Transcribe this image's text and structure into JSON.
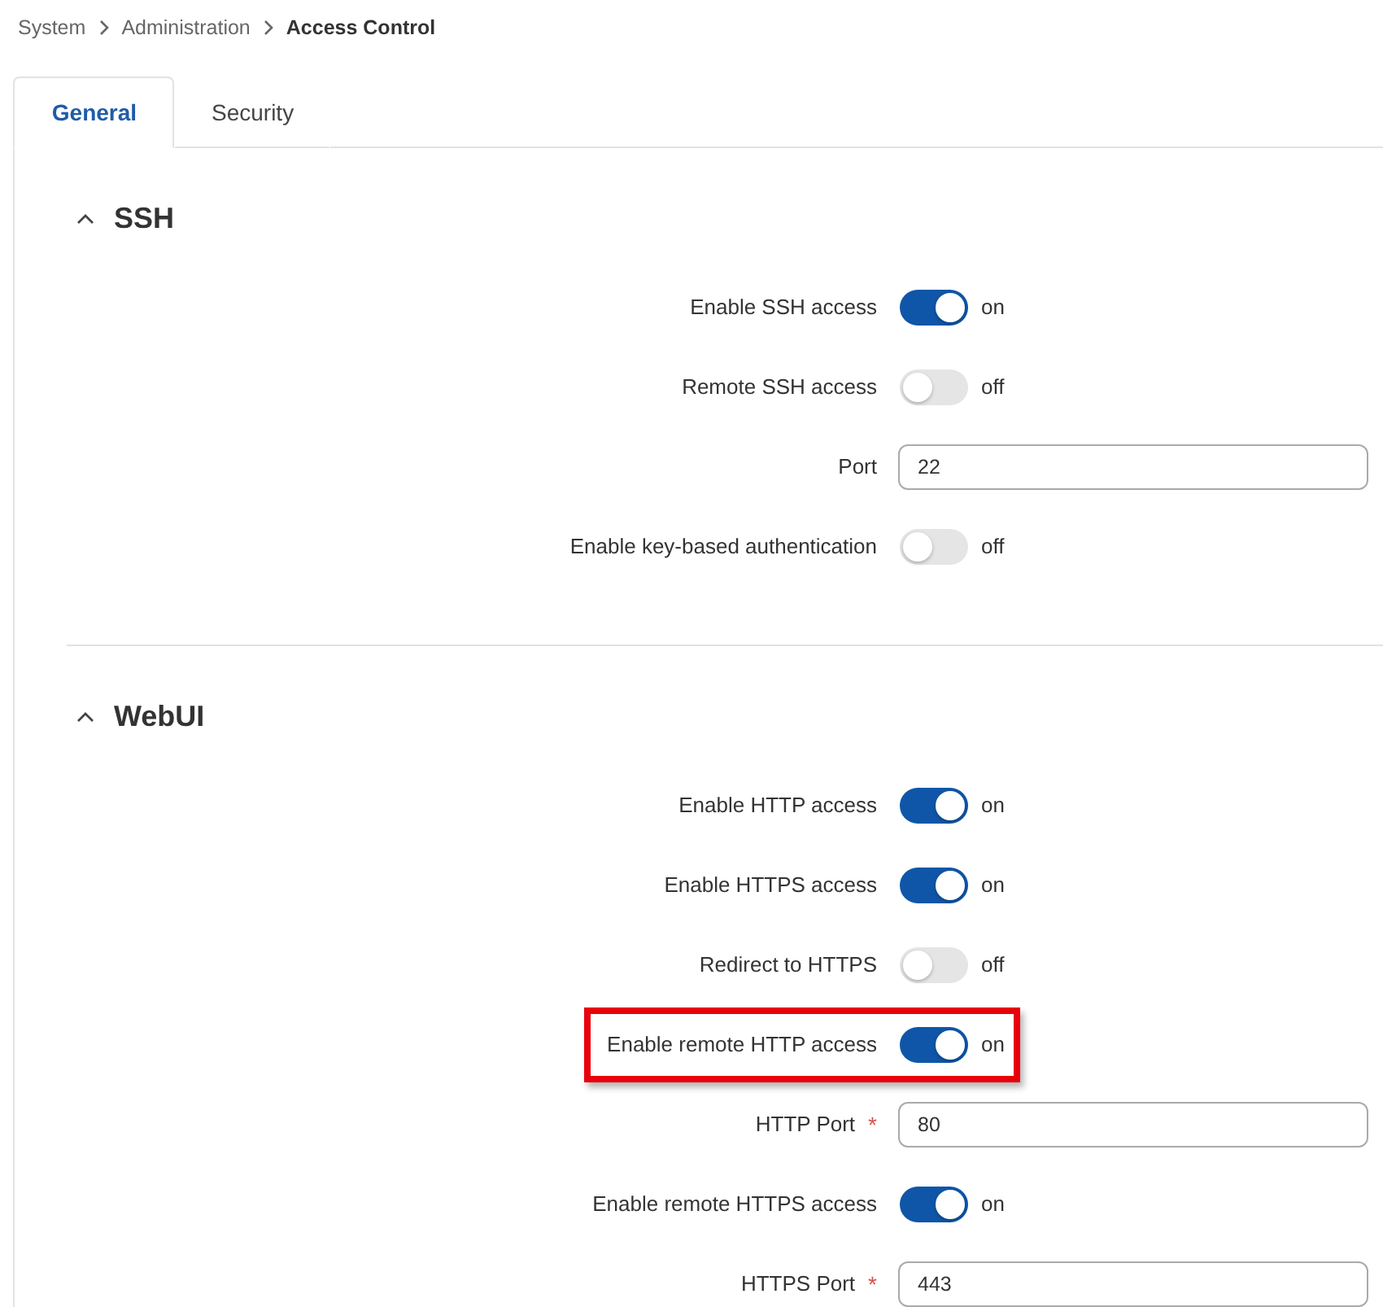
{
  "required_mark": "*",
  "breadcrumb": [
    "System",
    "Administration",
    "Access Control"
  ],
  "tabs": [
    {
      "label": "General",
      "selected": true
    },
    {
      "label": "Security",
      "selected": false
    }
  ],
  "sections": [
    {
      "title": "SSH",
      "expanded": true,
      "rows": [
        {
          "kind": "toggle",
          "label": "Enable SSH access",
          "on": true,
          "state_text": "on",
          "highlighted": false
        },
        {
          "kind": "toggle",
          "label": "Remote SSH access",
          "on": false,
          "state_text": "off",
          "highlighted": false
        },
        {
          "kind": "field",
          "label": "Port",
          "required": false,
          "value": "22",
          "highlighted": false
        },
        {
          "kind": "toggle",
          "label": "Enable key-based authentication",
          "on": false,
          "state_text": "off",
          "highlighted": false
        }
      ]
    },
    {
      "title": "WebUI",
      "expanded": true,
      "rows": [
        {
          "kind": "toggle",
          "label": "Enable HTTP access",
          "on": true,
          "state_text": "on",
          "highlighted": false
        },
        {
          "kind": "toggle",
          "label": "Enable HTTPS access",
          "on": true,
          "state_text": "on",
          "highlighted": false
        },
        {
          "kind": "toggle",
          "label": "Redirect to HTTPS",
          "on": false,
          "state_text": "off",
          "highlighted": false
        },
        {
          "kind": "toggle",
          "label": "Enable remote HTTP access",
          "on": true,
          "state_text": "on",
          "highlighted": true
        },
        {
          "kind": "field",
          "label": "HTTP Port",
          "required": true,
          "value": "80",
          "highlighted": false
        },
        {
          "kind": "toggle",
          "label": "Enable remote HTTPS access",
          "on": true,
          "state_text": "on",
          "highlighted": false
        },
        {
          "kind": "field",
          "label": "HTTPS Port",
          "required": true,
          "value": "443",
          "highlighted": false
        }
      ]
    }
  ]
}
